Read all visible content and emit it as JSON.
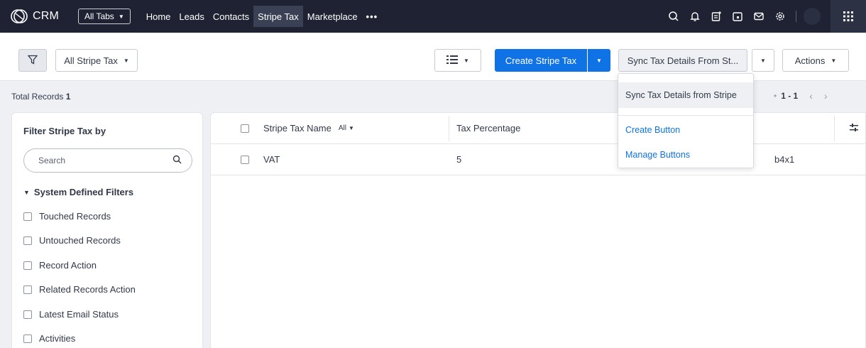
{
  "nav": {
    "app_name": "CRM",
    "all_tabs_label": "All Tabs",
    "tabs": [
      {
        "label": "Home"
      },
      {
        "label": "Leads"
      },
      {
        "label": "Contacts"
      },
      {
        "label": "Stripe Tax",
        "active": true
      },
      {
        "label": "Marketplace"
      },
      {
        "label": "•••"
      }
    ],
    "icons": [
      "search-icon",
      "bell-icon",
      "notes-icon",
      "calendar-icon",
      "mail-icon",
      "gear-icon",
      "apps-grid-icon"
    ]
  },
  "toolbar": {
    "view_label": "All Stripe Tax",
    "create_label": "Create Stripe Tax",
    "sync_label": "Sync Tax Details From St...",
    "actions_label": "Actions"
  },
  "records": {
    "total_label": "Total Records",
    "total_count": "1",
    "range": "1 - 1"
  },
  "filters": {
    "title": "Filter Stripe Tax by",
    "search_placeholder": "Search",
    "section_label": "System Defined Filters",
    "items": [
      {
        "label": "Touched Records"
      },
      {
        "label": "Untouched Records"
      },
      {
        "label": "Record Action"
      },
      {
        "label": "Related Records Action"
      },
      {
        "label": "Latest Email Status"
      },
      {
        "label": "Activities"
      }
    ]
  },
  "table": {
    "columns": [
      {
        "label": "Stripe Tax Name",
        "filter": "All"
      },
      {
        "label": "Tax Percentage"
      }
    ],
    "rows": [
      {
        "name": "VAT",
        "percentage": "5",
        "id_tail": "b4x1"
      }
    ]
  },
  "dropdown": {
    "items": [
      {
        "label": "Sync Tax Details from Stripe"
      },
      {
        "label": "Create Button"
      },
      {
        "label": "Manage Buttons"
      }
    ]
  },
  "colors": {
    "nav_bg": "#1e2233",
    "primary": "#0f73e6",
    "page_bg": "#eef0f4"
  }
}
